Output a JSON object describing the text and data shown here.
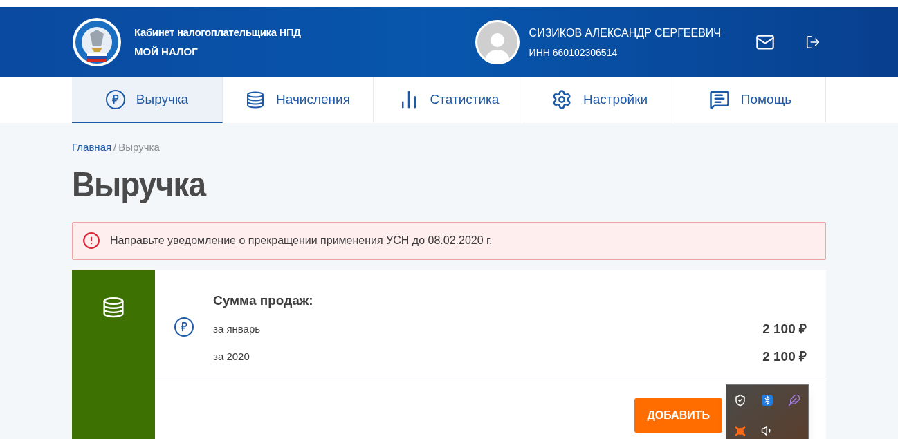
{
  "header": {
    "title": "Кабинет налогоплательщика НПД",
    "subtitle": "МОЙ НАЛОГ",
    "user_name": "СИЗИКОВ АЛЕКСАНДР СЕРГЕЕВИЧ",
    "inn": "ИНН 660102306514"
  },
  "tabs": [
    {
      "kind": "ruble",
      "label": "Выручка",
      "selected": true
    },
    {
      "kind": "coins",
      "label": "Начисления",
      "selected": false
    },
    {
      "kind": "chart",
      "label": "Статистика",
      "selected": false
    },
    {
      "kind": "settings",
      "label": "Настройки",
      "selected": false
    },
    {
      "kind": "help",
      "label": "Помощь",
      "selected": false
    }
  ],
  "breadcrumbs": [
    {
      "label": "Главная",
      "kind": "link"
    },
    {
      "label": "/",
      "kind": "separator"
    },
    {
      "label": "Выручка",
      "kind": "current"
    }
  ],
  "page_title": "Выручка",
  "alert": {
    "text": "Направьте уведомление о прекращении применения УСН до 08.02.2020 г."
  },
  "sales_card": {
    "heading": "Сумма продаж:",
    "rows": [
      {
        "label": "за январь",
        "value": "2 100 ₽"
      },
      {
        "label": "за 2020",
        "value": "2 100 ₽"
      }
    ],
    "button": "ДОБАВИТЬ"
  }
}
